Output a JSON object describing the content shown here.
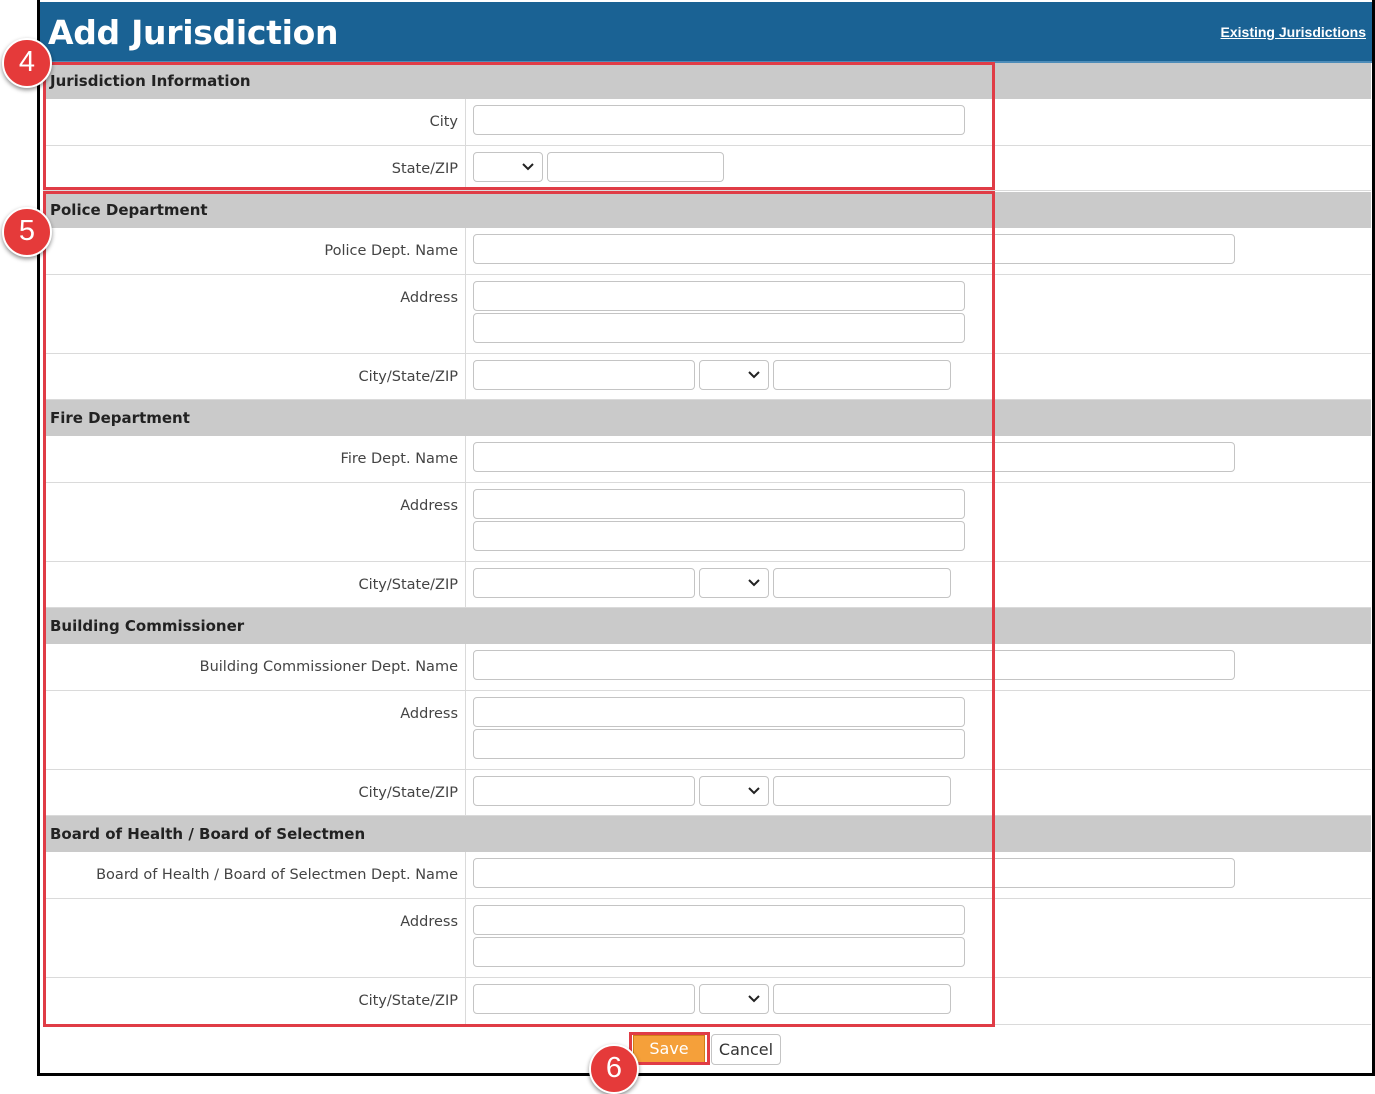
{
  "header": {
    "title": "Add Jurisdiction",
    "existing_link": "Existing Jurisdictions"
  },
  "jurisdiction": {
    "heading": "Jurisdiction Information",
    "city_label": "City",
    "state_zip_label": "State/ZIP"
  },
  "police": {
    "heading": "Police Department",
    "name_label": "Police Dept. Name",
    "address_label": "Address",
    "csz_label": "City/State/ZIP"
  },
  "fire": {
    "heading": "Fire Department",
    "name_label": "Fire Dept. Name",
    "address_label": "Address",
    "csz_label": "City/State/ZIP"
  },
  "building": {
    "heading": "Building Commissioner",
    "name_label": "Building Commissioner Dept. Name",
    "address_label": "Address",
    "csz_label": "City/State/ZIP"
  },
  "health": {
    "heading": "Board of Health / Board of Selectmen",
    "name_label": "Board of Health / Board of Selectmen Dept. Name",
    "address_label": "Address",
    "csz_label": "City/State/ZIP"
  },
  "buttons": {
    "save": "Save",
    "cancel": "Cancel"
  },
  "annotations": {
    "badge_4": "4",
    "badge_5": "5",
    "badge_6": "6",
    "highlight_color": "#e03c46"
  },
  "colors": {
    "header_bg": "#1a6294",
    "section_bg": "#cacaca",
    "save_bg": "#f5a03a"
  }
}
